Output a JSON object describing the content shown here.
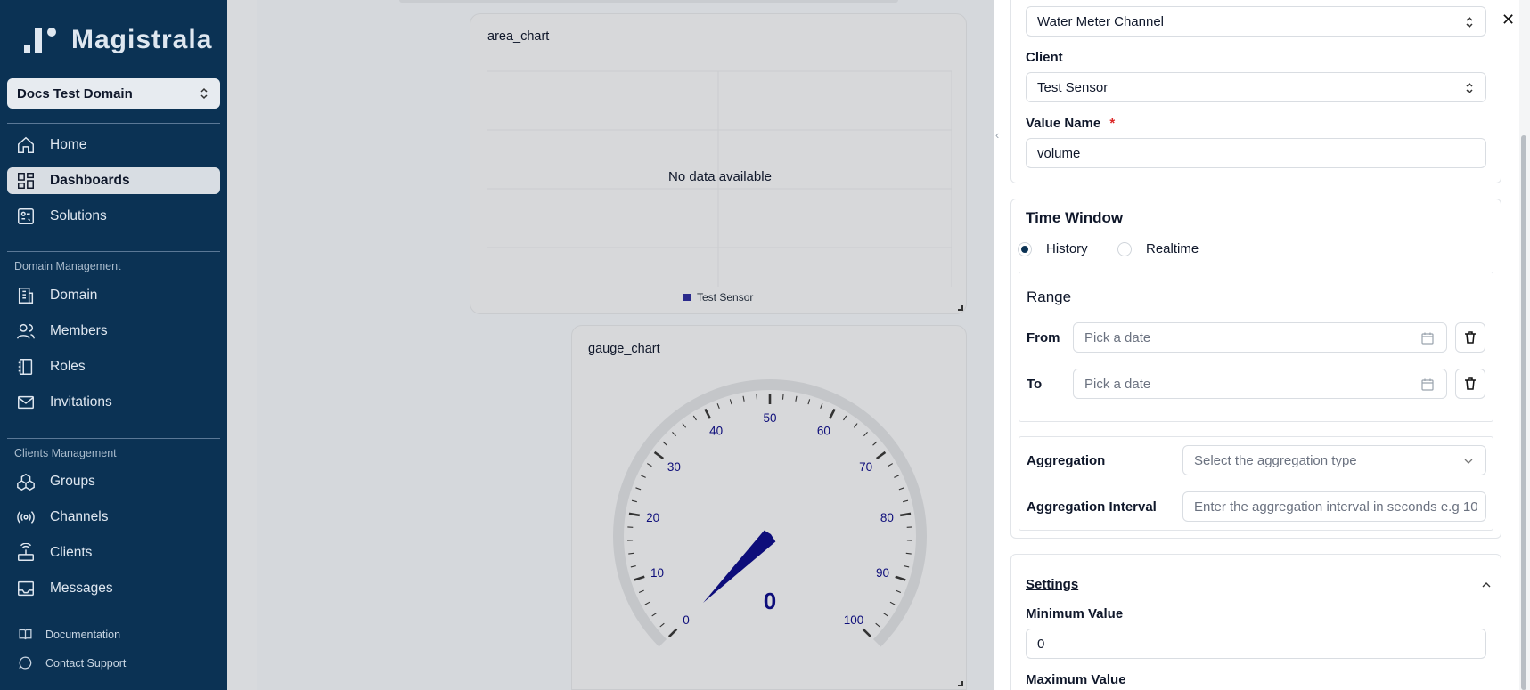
{
  "app": {
    "name": "Magistrala"
  },
  "domain_selector": {
    "value": "Docs Test Domain"
  },
  "sidebar": {
    "main_items": [
      {
        "label": "Home",
        "icon": "home-icon"
      },
      {
        "label": "Dashboards",
        "icon": "dashboard-icon",
        "active": true
      },
      {
        "label": "Solutions",
        "icon": "solutions-icon"
      }
    ],
    "domain_section_label": "Domain Management",
    "domain_items": [
      {
        "label": "Domain",
        "icon": "building-icon"
      },
      {
        "label": "Members",
        "icon": "users-icon"
      },
      {
        "label": "Roles",
        "icon": "book-icon"
      },
      {
        "label": "Invitations",
        "icon": "mail-icon"
      }
    ],
    "clients_section_label": "Clients Management",
    "client_items": [
      {
        "label": "Groups",
        "icon": "groups-icon"
      },
      {
        "label": "Channels",
        "icon": "radio-icon"
      },
      {
        "label": "Clients",
        "icon": "router-icon"
      },
      {
        "label": "Messages",
        "icon": "messages-icon"
      }
    ],
    "footer_items": [
      {
        "label": "Documentation",
        "icon": "docs-icon"
      },
      {
        "label": "Contact Support",
        "icon": "chat-icon"
      }
    ]
  },
  "widgets": {
    "area_chart": {
      "title": "area_chart",
      "empty_text": "No data available",
      "legend_label": "Test Sensor"
    },
    "gauge_chart": {
      "title": "gauge_chart",
      "value_text": "0",
      "tick_labels": [
        "0",
        "10",
        "20",
        "30",
        "40",
        "50",
        "60",
        "70",
        "80",
        "90",
        "100"
      ]
    }
  },
  "chart_data": {
    "type": "gauge",
    "title": "gauge_chart",
    "min": 0,
    "max": 100,
    "value": 0,
    "ticks": [
      0,
      10,
      20,
      30,
      40,
      50,
      60,
      70,
      80,
      90,
      100
    ]
  },
  "panel": {
    "channel_select": {
      "value": "Water Meter Channel"
    },
    "client": {
      "label": "Client",
      "value": "Test Sensor"
    },
    "value_name": {
      "label": "Value Name",
      "required_mark": "*",
      "value": "volume"
    },
    "time_window": {
      "heading": "Time Window",
      "options": [
        {
          "label": "History",
          "checked": true
        },
        {
          "label": "Realtime",
          "checked": false
        }
      ]
    },
    "range": {
      "heading": "Range",
      "from_label": "From",
      "to_label": "To",
      "from_placeholder": "Pick a date",
      "to_placeholder": "Pick a date"
    },
    "aggregation": {
      "label": "Aggregation",
      "placeholder": "Select the aggregation type"
    },
    "aggregation_interval": {
      "label": "Aggregation Interval",
      "placeholder": "Enter the aggregation interval in seconds e.g 10"
    },
    "settings": {
      "heading": "Settings",
      "min_label": "Minimum Value",
      "min_value": "0",
      "max_label": "Maximum Value"
    }
  },
  "colors": {
    "sidebar_bg": "#0b3254",
    "accent": "#0b3254",
    "gauge_needle": "#0d0d7a",
    "required": "#dc2626"
  }
}
